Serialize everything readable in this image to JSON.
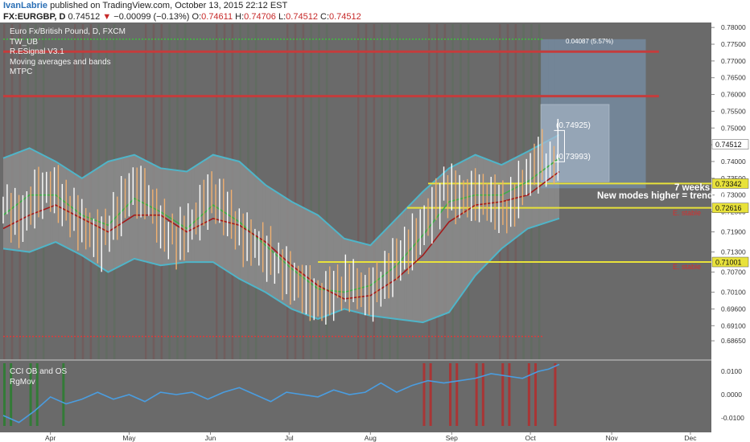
{
  "header": {
    "author": "IvanLabrie",
    "published_text": " published on TradingView.com, October 13, 2015 22:12 EST",
    "symbol": "FX:EURGBP, D",
    "price": "0.74512",
    "change_arrow": "▼",
    "change": "−0.00099 (−0.13%)",
    "o_label": "O:",
    "o_value": "0.74611",
    "h_label": "H:",
    "h_value": "0.74706",
    "l_label": "L:",
    "l_value": "0.74512",
    "c_label": "C:",
    "c_value": "0.74512"
  },
  "indicators": {
    "main_title": "Euro Fx/British Pound, D, FXCM",
    "list": [
      "TW_UB",
      "R.ESignal V3.1",
      "Moving averages and bands",
      "MTPC"
    ],
    "bottom_list": [
      "CCI OB and OS",
      "RgMov"
    ]
  },
  "annotations": {
    "weeks": "7 weeks",
    "modes": "New modes higher = trend up",
    "red_label_1": "E. stable",
    "red_label_2": "E. stable",
    "projection": "0.04087 (5.57%)",
    "bracket_high": "(0.74925)",
    "bracket_low": "(0.73993)"
  },
  "colors": {
    "bg": "#6a6a6a",
    "band": "#8c8c8c",
    "band_edge": "#4fb5c9",
    "ma_green": "#3fae49",
    "ma_red": "#a31b1b",
    "yellow": "#e8e23a",
    "red_line": "#c43c3c",
    "up_bar": "#ffffff",
    "down_bar": "#f0b070",
    "cci_line": "#4a9de0"
  },
  "chart_data": {
    "type": "line",
    "title": "Euro Fx/British Pound, D, FXCM",
    "y_range": [
      0.681,
      0.781
    ],
    "y_ticks": [
      "0.78000",
      "0.77500",
      "0.77000",
      "0.76500",
      "0.76000",
      "0.75500",
      "0.75000",
      "0.74500",
      "0.74000",
      "0.73500",
      "0.73000",
      "0.72500",
      "0.71900",
      "0.71300",
      "0.70700",
      "0.70100",
      "0.69600",
      "0.69100",
      "0.68650"
    ],
    "y_tick_values": [
      0.78,
      0.775,
      0.77,
      0.765,
      0.76,
      0.755,
      0.75,
      0.745,
      0.74,
      0.735,
      0.73,
      0.725,
      0.719,
      0.713,
      0.707,
      0.701,
      0.696,
      0.691,
      0.6865
    ],
    "price_tags": [
      {
        "label": "0.74512",
        "value": 0.74512,
        "style": "current"
      },
      {
        "label": "0.73342",
        "value": 0.73342,
        "style": "yellow"
      },
      {
        "label": "0.72616",
        "value": 0.72616,
        "style": "yellow"
      },
      {
        "label": "0.71001",
        "value": 0.71001,
        "style": "yellow"
      }
    ],
    "x_labels": [
      "Apr",
      "May",
      "Jun",
      "Jul",
      "Aug",
      "Sep",
      "Oct",
      "Nov",
      "Dec"
    ],
    "x_label_days": [
      18,
      48,
      79,
      109,
      140,
      171,
      201,
      232,
      262
    ],
    "x_range": [
      0,
      270
    ],
    "close": [
      [
        0,
        0.727
      ],
      [
        6,
        0.722
      ],
      [
        12,
        0.73
      ],
      [
        18,
        0.732
      ],
      [
        24,
        0.726
      ],
      [
        30,
        0.721
      ],
      [
        36,
        0.716
      ],
      [
        42,
        0.723
      ],
      [
        48,
        0.732
      ],
      [
        54,
        0.73
      ],
      [
        60,
        0.72
      ],
      [
        66,
        0.716
      ],
      [
        72,
        0.722
      ],
      [
        78,
        0.73
      ],
      [
        84,
        0.726
      ],
      [
        90,
        0.718
      ],
      [
        96,
        0.715
      ],
      [
        102,
        0.711
      ],
      [
        108,
        0.706
      ],
      [
        114,
        0.702
      ],
      [
        120,
        0.698
      ],
      [
        126,
        0.702
      ],
      [
        132,
        0.704
      ],
      [
        138,
        0.7
      ],
      [
        144,
        0.704
      ],
      [
        150,
        0.711
      ],
      [
        156,
        0.716
      ],
      [
        162,
        0.724
      ],
      [
        168,
        0.732
      ],
      [
        174,
        0.729
      ],
      [
        180,
        0.73
      ],
      [
        186,
        0.728
      ],
      [
        192,
        0.725
      ],
      [
        198,
        0.734
      ],
      [
        204,
        0.741
      ],
      [
        208,
        0.738
      ],
      [
        212,
        0.7451
      ]
    ],
    "upper_band": [
      [
        0,
        0.741
      ],
      [
        10,
        0.744
      ],
      [
        20,
        0.74
      ],
      [
        30,
        0.735
      ],
      [
        40,
        0.74
      ],
      [
        50,
        0.742
      ],
      [
        60,
        0.738
      ],
      [
        70,
        0.737
      ],
      [
        80,
        0.742
      ],
      [
        90,
        0.74
      ],
      [
        100,
        0.733
      ],
      [
        110,
        0.728
      ],
      [
        120,
        0.724
      ],
      [
        130,
        0.717
      ],
      [
        140,
        0.715
      ],
      [
        150,
        0.723
      ],
      [
        160,
        0.731
      ],
      [
        170,
        0.738
      ],
      [
        180,
        0.742
      ],
      [
        190,
        0.739
      ],
      [
        200,
        0.743
      ],
      [
        212,
        0.748
      ]
    ],
    "lower_band": [
      [
        0,
        0.714
      ],
      [
        10,
        0.713
      ],
      [
        20,
        0.716
      ],
      [
        30,
        0.712
      ],
      [
        40,
        0.707
      ],
      [
        50,
        0.711
      ],
      [
        60,
        0.709
      ],
      [
        70,
        0.71
      ],
      [
        80,
        0.71
      ],
      [
        90,
        0.705
      ],
      [
        100,
        0.701
      ],
      [
        110,
        0.696
      ],
      [
        120,
        0.693
      ],
      [
        130,
        0.696
      ],
      [
        140,
        0.694
      ],
      [
        150,
        0.693
      ],
      [
        160,
        0.692
      ],
      [
        170,
        0.695
      ],
      [
        180,
        0.706
      ],
      [
        190,
        0.714
      ],
      [
        200,
        0.72
      ],
      [
        212,
        0.723
      ]
    ],
    "ma_green": [
      [
        0,
        0.724
      ],
      [
        10,
        0.73
      ],
      [
        20,
        0.73
      ],
      [
        30,
        0.724
      ],
      [
        40,
        0.721
      ],
      [
        50,
        0.729
      ],
      [
        60,
        0.725
      ],
      [
        70,
        0.72
      ],
      [
        80,
        0.727
      ],
      [
        90,
        0.722
      ],
      [
        100,
        0.715
      ],
      [
        110,
        0.708
      ],
      [
        120,
        0.702
      ],
      [
        130,
        0.701
      ],
      [
        140,
        0.703
      ],
      [
        150,
        0.709
      ],
      [
        160,
        0.718
      ],
      [
        170,
        0.728
      ],
      [
        180,
        0.73
      ],
      [
        190,
        0.73
      ],
      [
        200,
        0.734
      ],
      [
        212,
        0.741
      ]
    ],
    "ma_red": [
      [
        0,
        0.72
      ],
      [
        10,
        0.724
      ],
      [
        20,
        0.727
      ],
      [
        30,
        0.723
      ],
      [
        40,
        0.719
      ],
      [
        50,
        0.724
      ],
      [
        60,
        0.724
      ],
      [
        70,
        0.719
      ],
      [
        80,
        0.723
      ],
      [
        90,
        0.721
      ],
      [
        100,
        0.716
      ],
      [
        110,
        0.709
      ],
      [
        120,
        0.703
      ],
      [
        130,
        0.699
      ],
      [
        140,
        0.7
      ],
      [
        150,
        0.705
      ],
      [
        160,
        0.712
      ],
      [
        170,
        0.722
      ],
      [
        180,
        0.727
      ],
      [
        190,
        0.728
      ],
      [
        200,
        0.73
      ],
      [
        212,
        0.737
      ]
    ],
    "horizontal_lines": [
      {
        "value": 0.73342,
        "x_start": 162,
        "color": "yellow"
      },
      {
        "value": 0.72616,
        "x_start": 154,
        "color": "yellow"
      },
      {
        "value": 0.71001,
        "x_start": 120,
        "color": "yellow"
      },
      {
        "value": 0.7595,
        "x_start": 0,
        "color": "red"
      },
      {
        "value": 0.7728,
        "x_start": 0,
        "color": "red"
      },
      {
        "value": 0.7765,
        "x_start": 0,
        "color": "green-dotted"
      },
      {
        "value": 0.6878,
        "x_start": 0,
        "color": "red-dotted"
      }
    ],
    "sub_panel": {
      "y_ticks": [
        "0.0100",
        "0.0000",
        "-0.0100"
      ],
      "y_tick_values": [
        0.01,
        0.0,
        -0.01
      ],
      "y_range": [
        -0.0135,
        0.0135
      ],
      "line": [
        [
          0,
          -0.009
        ],
        [
          6,
          -0.012
        ],
        [
          12,
          -0.007
        ],
        [
          18,
          -0.001
        ],
        [
          24,
          -0.004
        ],
        [
          30,
          -0.002
        ],
        [
          36,
          0.001
        ],
        [
          42,
          -0.002
        ],
        [
          48,
          0.0
        ],
        [
          54,
          -0.003
        ],
        [
          60,
          0.001
        ],
        [
          66,
          0.0
        ],
        [
          72,
          0.001
        ],
        [
          78,
          -0.002
        ],
        [
          84,
          0.001
        ],
        [
          90,
          0.003
        ],
        [
          96,
          0.0
        ],
        [
          102,
          -0.003
        ],
        [
          108,
          0.001
        ],
        [
          114,
          0.0
        ],
        [
          120,
          -0.001
        ],
        [
          126,
          0.002
        ],
        [
          132,
          0.0
        ],
        [
          138,
          0.001
        ],
        [
          144,
          0.005
        ],
        [
          150,
          0.001
        ],
        [
          156,
          0.004
        ],
        [
          162,
          0.006
        ],
        [
          168,
          0.005
        ],
        [
          174,
          0.006
        ],
        [
          180,
          0.007
        ],
        [
          186,
          0.009
        ],
        [
          192,
          0.008
        ],
        [
          198,
          0.007
        ],
        [
          204,
          0.01
        ],
        [
          208,
          0.011
        ],
        [
          212,
          0.013
        ]
      ]
    }
  }
}
